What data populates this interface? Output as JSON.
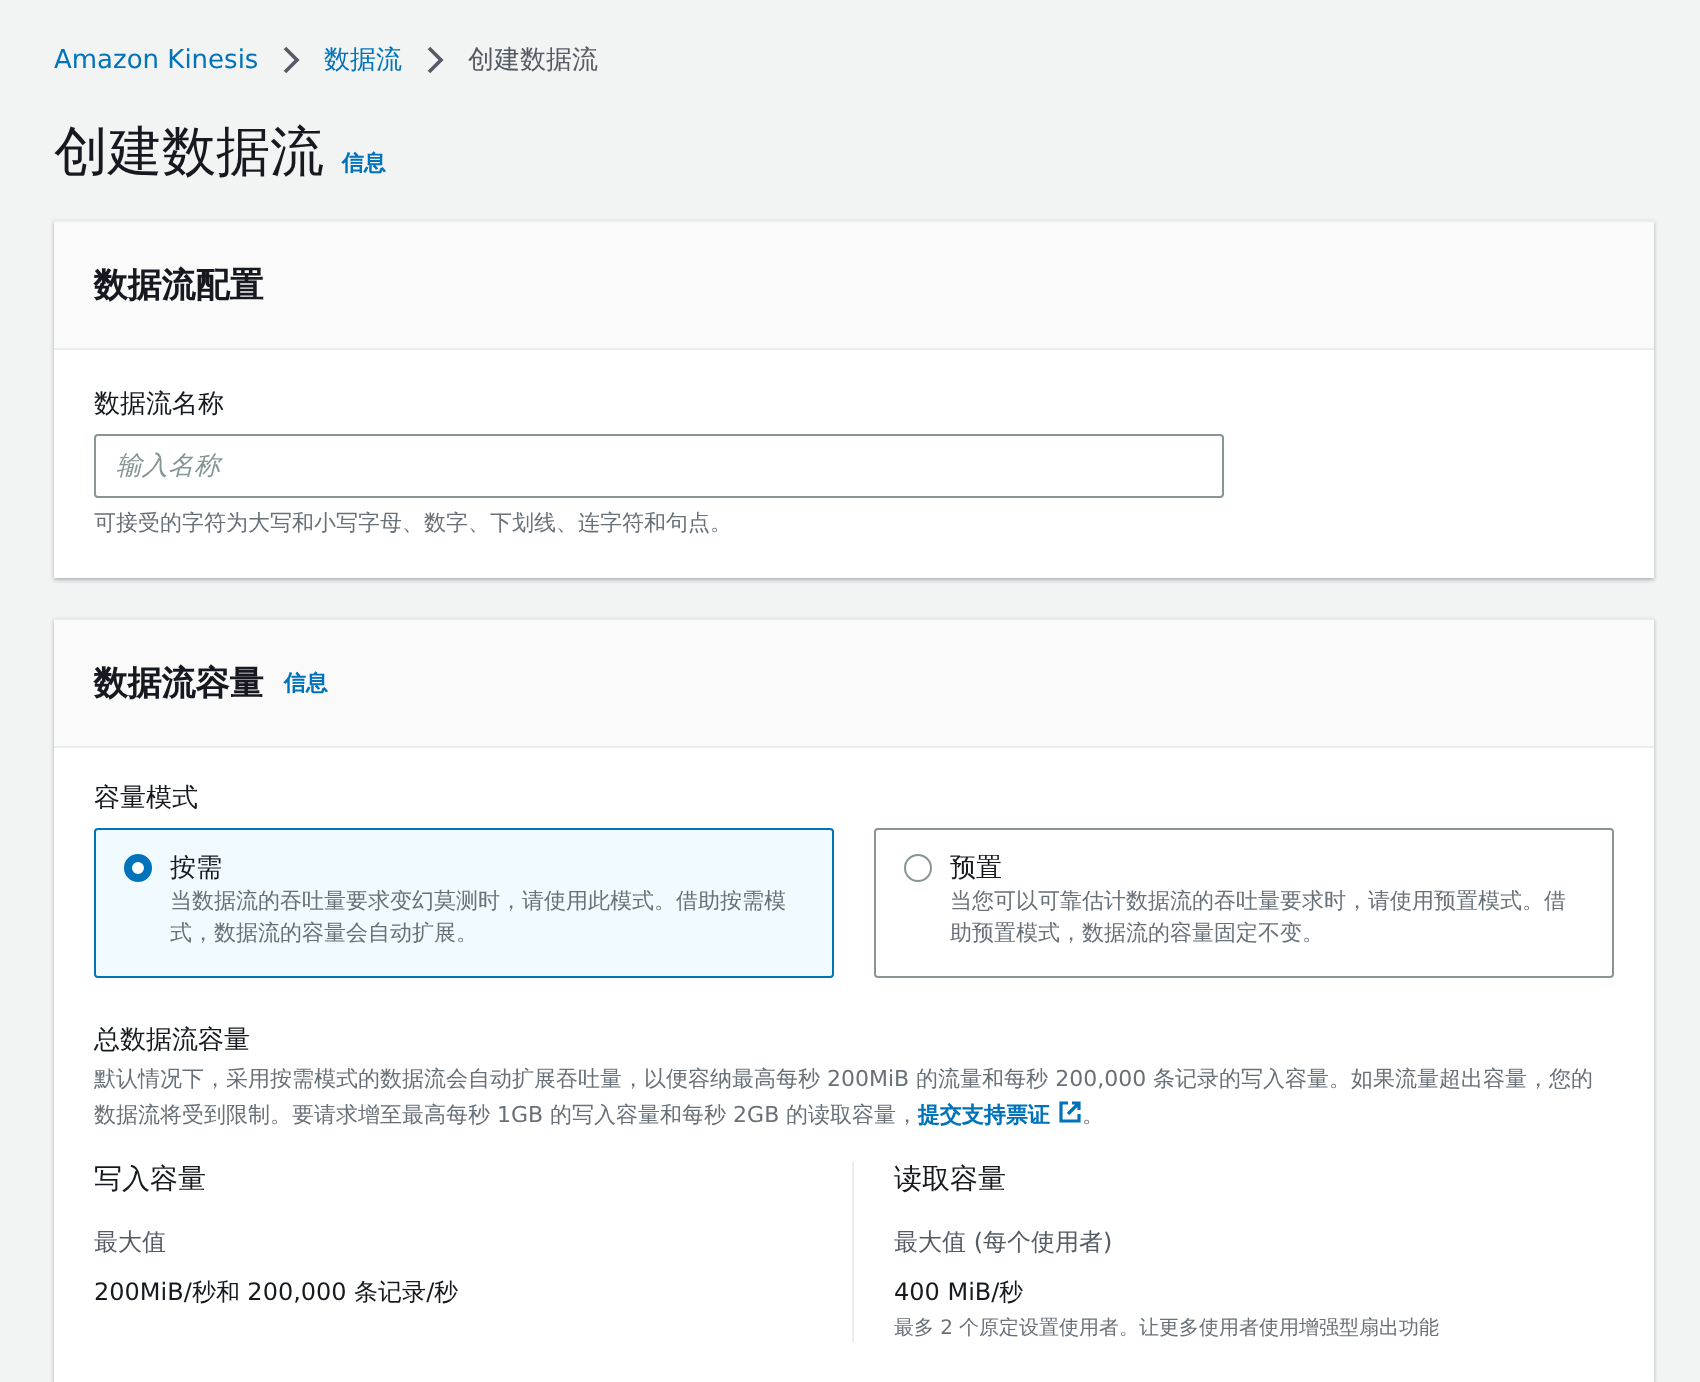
{
  "breadcrumbs": [
    {
      "label": "Amazon Kinesis",
      "link": true
    },
    {
      "label": "数据流",
      "link": true
    },
    {
      "label": "创建数据流",
      "link": false
    }
  ],
  "page_title": "创建数据流",
  "page_info": "信息",
  "config_panel": {
    "title": "数据流配置",
    "field_label": "数据流名称",
    "placeholder": "输入名称",
    "hint": "可接受的字符为大写和小写字母、数字、下划线、连字符和句点。"
  },
  "capacity_panel": {
    "title": "数据流容量",
    "info": "信息",
    "mode_label": "容量模式",
    "modes": [
      {
        "label": "按需",
        "description": "当数据流的吞吐量要求变幻莫测时，请使用此模式。借助按需模式，数据流的容量会自动扩展。",
        "selected": true
      },
      {
        "label": "预置",
        "description": "当您可以可靠估计数据流的吞吐量要求时，请使用预置模式。借助预置模式，数据流的容量固定不变。",
        "selected": false
      }
    ],
    "total_title": "总数据流容量",
    "total_text": "默认情况下，采用按需模式的数据流会自动扩展吞吐量，以便容纳最高每秒 200MiB 的流量和每秒 200,000 条记录的写入容量。如果流量超出容量，您的数据流将受到限制。要请求增至最高每秒 1GB 的写入容量和每秒 2GB 的读取容量，",
    "total_link": "提交支持票证",
    "total_end": "。",
    "columns": [
      {
        "title": "写入容量",
        "label": "最大值",
        "value": "200MiB/秒和 200,000 条记录/秒"
      },
      {
        "title": "读取容量",
        "label": "最大值 (每个使用者)",
        "value": "400 MiB/秒",
        "note": "最多 2 个原定设置使用者。让更多使用者使用增强型扇出功能"
      }
    ]
  }
}
